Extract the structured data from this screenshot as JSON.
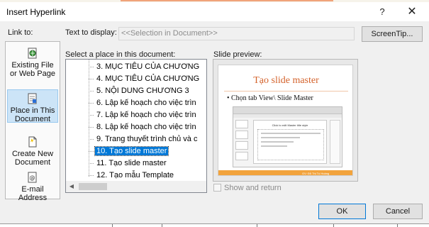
{
  "window": {
    "title": "Insert Hyperlink",
    "help_label": "?",
    "close_label": "✕"
  },
  "link_to": {
    "label": "Link to:",
    "items": [
      {
        "label": "Existing File or Web Page",
        "icon": "web-page-icon",
        "selected": false
      },
      {
        "label": "Place in This Document",
        "icon": "document-place-icon",
        "selected": true
      },
      {
        "label": "Create New Document",
        "icon": "new-document-icon",
        "selected": false
      },
      {
        "label": "E-mail Address",
        "icon": "email-icon",
        "selected": false
      }
    ]
  },
  "text_to_display": {
    "label": "Text to display:",
    "value": "<<Selection in Document>>"
  },
  "screentip_label": "ScreenTip...",
  "place": {
    "label": "Select a place in this document:",
    "items": [
      "3. MỤC TIÊU CỦA CHƯƠNG",
      "4. MỤC TIÊU CỦA CHƯƠNG",
      "5. NỘI DUNG CHƯƠNG 3",
      "6. Lập kế hoạch cho việc trìn",
      "7. Lập kế hoạch cho việc trìn",
      "8. Lập kế hoạch cho việc trìn",
      "9. Trang thuyết trình chủ và c",
      "10. Tạo slide master",
      "11. Tạo slide master",
      "12. Tạo mẫu Template"
    ],
    "selected_index": 7
  },
  "preview": {
    "label": "Slide preview:",
    "slide_title": "Tạo slide master",
    "slide_bullet": "• Chọn tab View\\ Slide Master",
    "inner_caption": "Click to edit Master title style",
    "footer_text": "GV: Đỗ Thị Tú Hoàng"
  },
  "show_and_return": {
    "label": "Show and return",
    "checked": false
  },
  "buttons": {
    "ok": "OK",
    "cancel": "Cancel"
  },
  "colors": {
    "accent": "#0078d7",
    "selection_panel": "#cce4f7",
    "slide_title": "#d4622b",
    "slide_footer": "#f2a33c"
  }
}
